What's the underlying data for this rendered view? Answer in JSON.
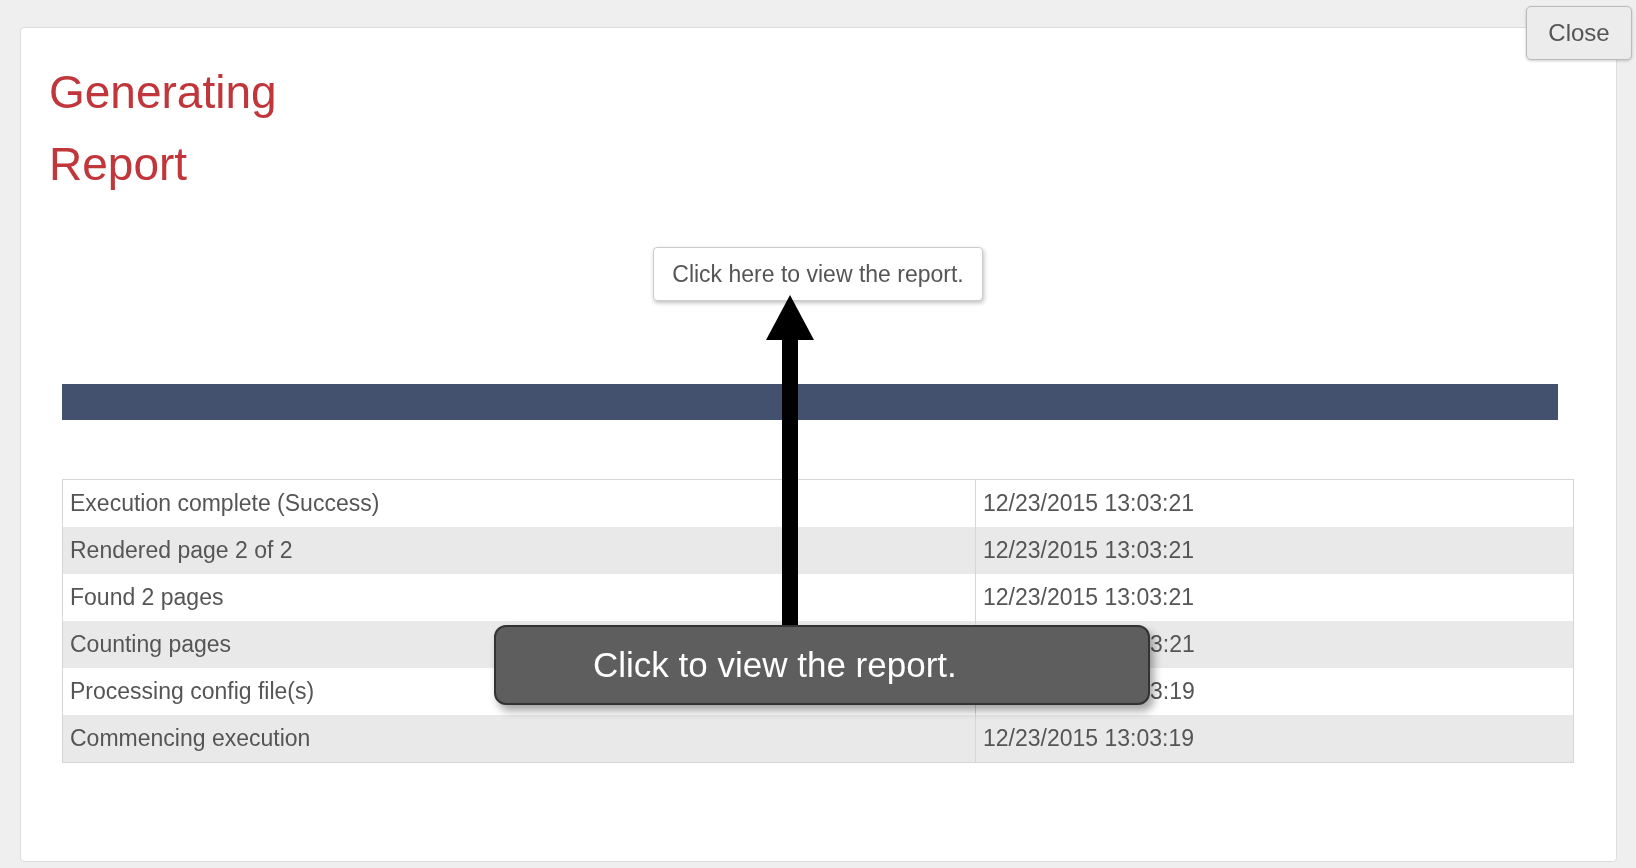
{
  "dialog": {
    "title_lines": [
      "Generating",
      "Report"
    ],
    "close_button": "Close",
    "view_button": "Click here to view the report."
  },
  "log": {
    "rows": [
      {
        "message": "Execution complete (Success)",
        "time": "12/23/2015 13:03:21",
        "covered": false
      },
      {
        "message": "Rendered page 2 of 2",
        "time": "12/23/2015 13:03:21",
        "covered": false
      },
      {
        "message": "Found 2 pages",
        "time": "12/23/2015 13:03:21",
        "covered": false
      },
      {
        "message": "Counting pages",
        "time": "3:21",
        "covered": true
      },
      {
        "message": "Processing config file(s)",
        "time": "3:19",
        "covered": true
      },
      {
        "message": "Commencing execution",
        "time": "12/23/2015 13:03:19",
        "covered": false
      }
    ]
  },
  "callout": {
    "text": "Click to view the report."
  }
}
